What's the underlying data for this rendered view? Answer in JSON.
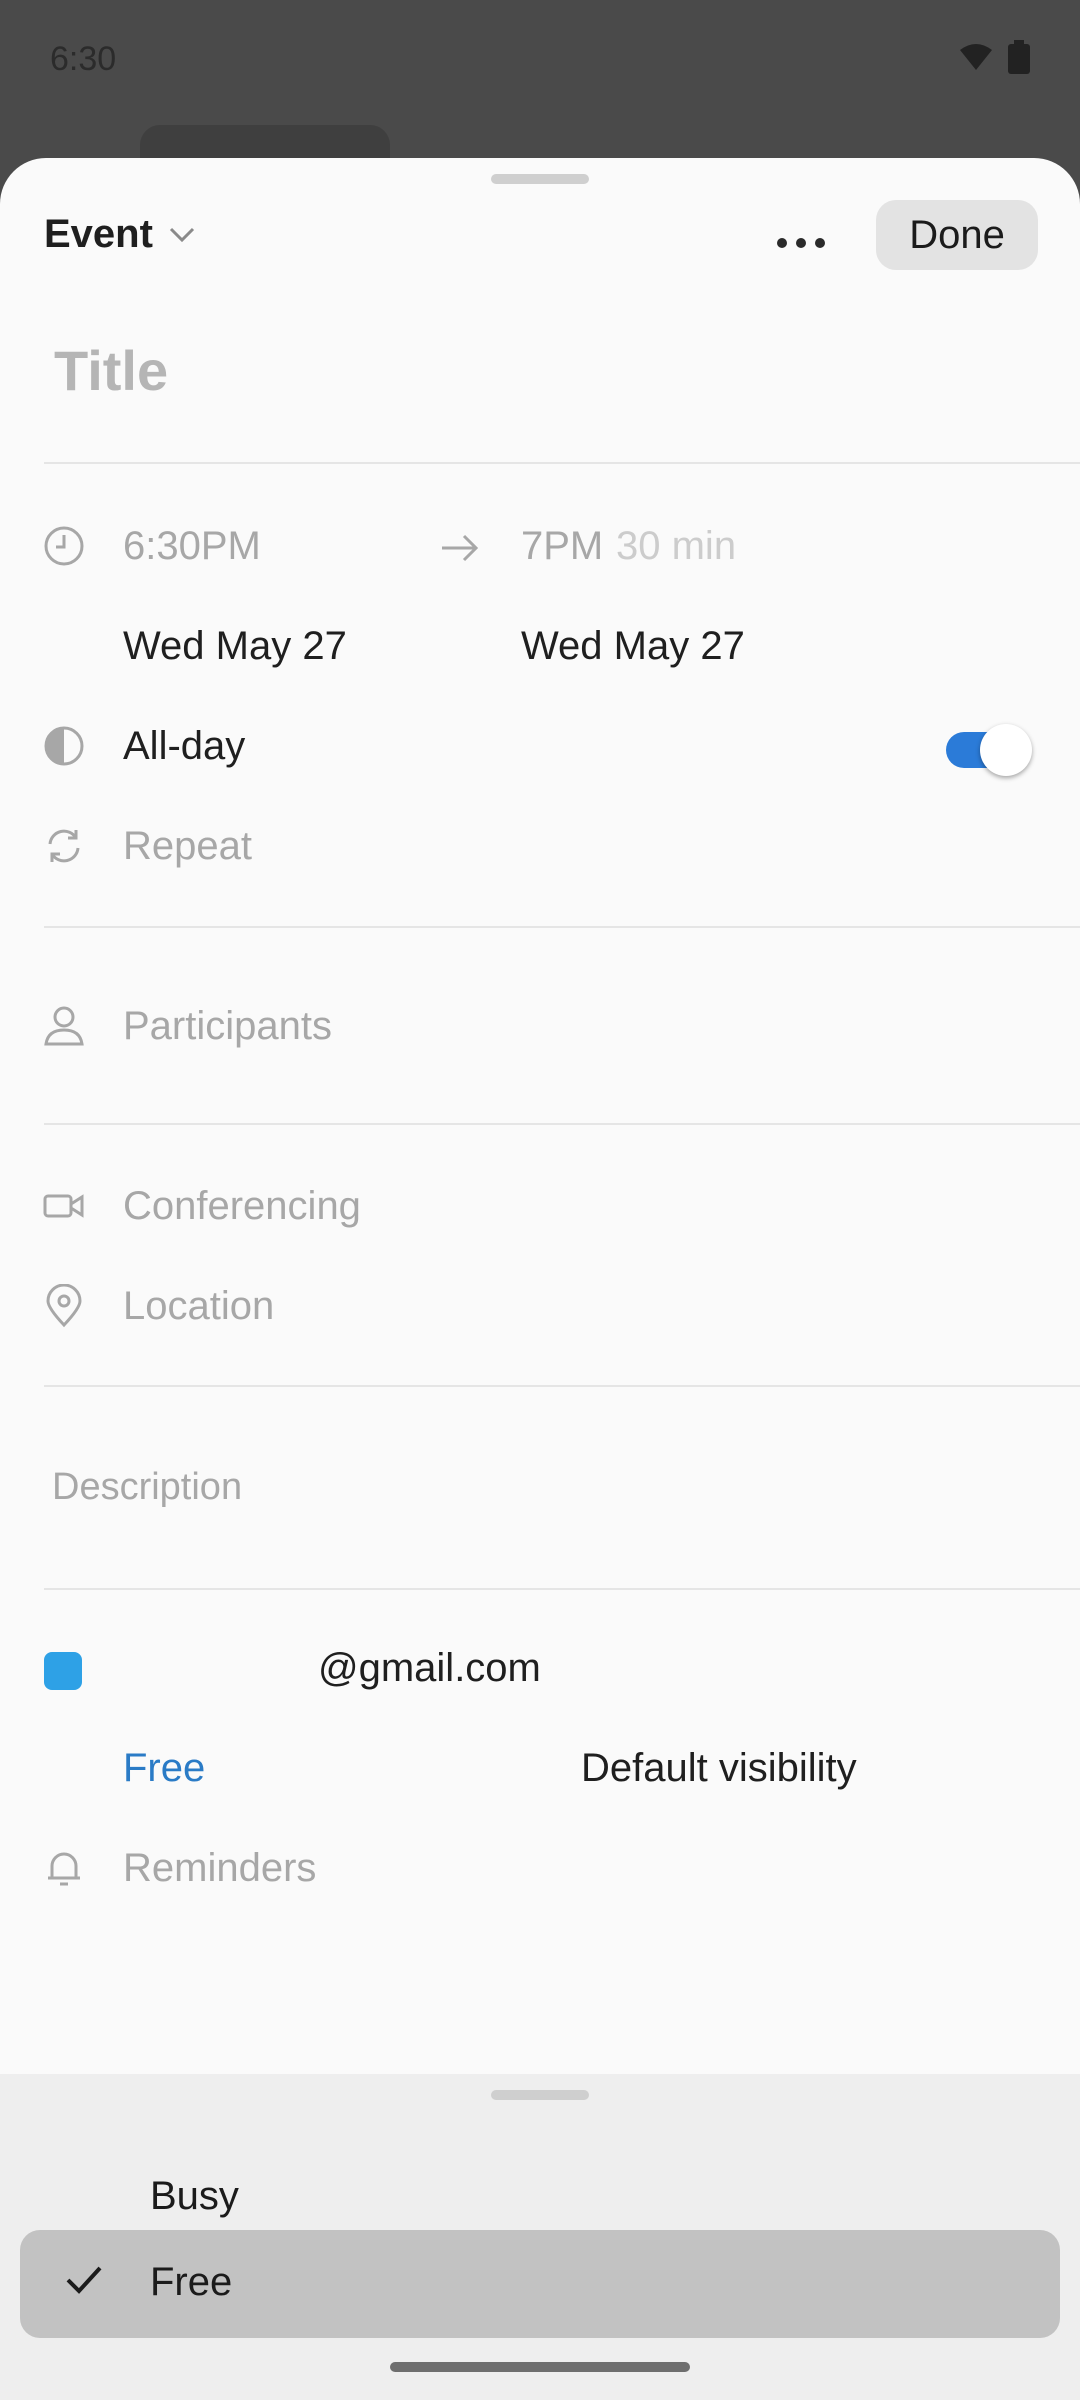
{
  "status_bar": {
    "time": "6:30"
  },
  "header": {
    "event_type": "Event",
    "done_label": "Done"
  },
  "title": {
    "placeholder": "Title",
    "value": ""
  },
  "time": {
    "start_time": "6:30PM",
    "end_time": "7PM",
    "duration": "30 min",
    "start_date": "Wed May 27",
    "end_date": "Wed May 27"
  },
  "all_day": {
    "label": "All-day",
    "enabled": true
  },
  "repeat": {
    "label": "Repeat"
  },
  "participants": {
    "label": "Participants"
  },
  "conferencing": {
    "label": "Conferencing"
  },
  "location": {
    "label": "Location"
  },
  "description": {
    "placeholder": "Description"
  },
  "calendar": {
    "account": "@gmail.com",
    "color": "#2ea1e6",
    "availability": "Free",
    "visibility": "Default visibility"
  },
  "reminders": {
    "label": "Reminders"
  },
  "availability_picker": {
    "options": [
      {
        "label": "Busy",
        "selected": false
      },
      {
        "label": "Free",
        "selected": true
      }
    ]
  },
  "colors": {
    "accent": "#2b7bd8",
    "availability_text": "#2a7bc6"
  }
}
